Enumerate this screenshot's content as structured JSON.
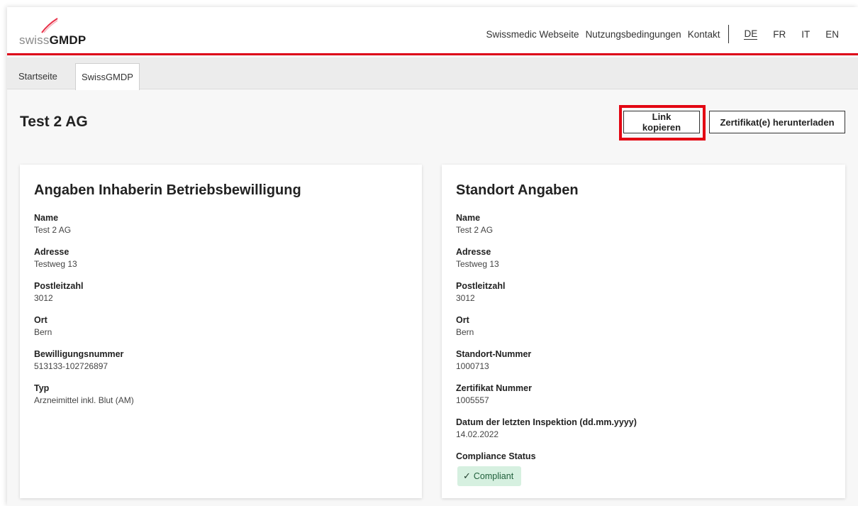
{
  "header": {
    "logo": {
      "swiss": "swiss",
      "gmdp": "GMDP"
    },
    "nav": [
      "Swissmedic Webseite",
      "Nutzungsbedingungen",
      "Kontakt"
    ],
    "languages": [
      "DE",
      "FR",
      "IT",
      "EN"
    ],
    "active_language": "DE",
    "accent_color": "#dc0018"
  },
  "tabs": [
    "Startseite",
    "SwissGMDP"
  ],
  "active_tab": "SwissGMDP",
  "page": {
    "title": "Test 2 AG",
    "copy_link_label": "Link kopieren",
    "download_label": "Zertifikat(e) herunterladen",
    "highlight_color": "#e30613"
  },
  "left_card": {
    "title": "Angaben Inhaberin Betriebsbewilligung",
    "fields": [
      {
        "label": "Name",
        "value": "Test 2 AG"
      },
      {
        "label": "Adresse",
        "value": "Testweg 13"
      },
      {
        "label": "Postleitzahl",
        "value": "3012"
      },
      {
        "label": "Ort",
        "value": "Bern"
      },
      {
        "label": "Bewilligungsnummer",
        "value": "513133-102726897"
      },
      {
        "label": "Typ",
        "value": "Arzneimittel inkl. Blut (AM)"
      }
    ]
  },
  "right_card": {
    "title": "Standort Angaben",
    "fields": [
      {
        "label": "Name",
        "value": "Test 2 AG"
      },
      {
        "label": "Adresse",
        "value": "Testweg 13"
      },
      {
        "label": "Postleitzahl",
        "value": "3012"
      },
      {
        "label": "Ort",
        "value": "Bern"
      },
      {
        "label": "Standort-Nummer",
        "value": "1000713"
      },
      {
        "label": "Zertifikat Nummer",
        "value": "1005557"
      },
      {
        "label": "Datum der letzten Inspektion (dd.mm.yyyy)",
        "value": "14.02.2022"
      }
    ],
    "compliance": {
      "label": "Compliance Status",
      "value": "Compliant",
      "icon": "check-icon",
      "color": "#d6f0e0"
    }
  }
}
